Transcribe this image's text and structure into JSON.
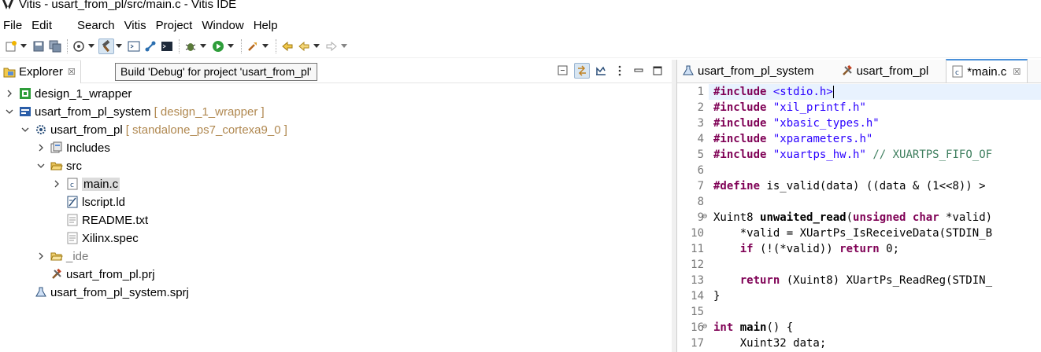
{
  "window": {
    "title": "Vitis - usart_from_pl/src/main.c - Vitis IDE"
  },
  "menu": [
    "File",
    "Edit",
    "Search",
    "Vitis",
    "Project",
    "Window",
    "Help"
  ],
  "toolbar": {
    "tooltip": "Build 'Debug' for project 'usart_from_pl'",
    "buttons": [
      "new-icon",
      "save-icon",
      "save-all-icon",
      "target-icon",
      "build-hammer-icon",
      "console-icon",
      "connect-icon",
      "terminal-icon",
      "debug-icon",
      "run-icon",
      "launch-icon",
      "prev-edit-icon",
      "back-icon",
      "forward-icon"
    ]
  },
  "explorer": {
    "tab_label": "Explorer",
    "close_glyph": "☒",
    "tree": [
      {
        "label": "design_1_wrapper",
        "deco": "",
        "icon": "platform-icon",
        "depth": 0,
        "expanded": false,
        "hasChildren": true
      },
      {
        "label": "usart_from_pl_system",
        "deco": "[ design_1_wrapper ]",
        "icon": "system-project-icon",
        "depth": 0,
        "expanded": true,
        "hasChildren": true
      },
      {
        "label": "usart_from_pl",
        "deco": "[ standalone_ps7_cortexa9_0 ]",
        "icon": "application-project-icon",
        "depth": 1,
        "expanded": true,
        "hasChildren": true
      },
      {
        "label": "Includes",
        "deco": "",
        "icon": "includes-icon",
        "depth": 2,
        "expanded": false,
        "hasChildren": true
      },
      {
        "label": "src",
        "deco": "",
        "icon": "folder-open-icon",
        "depth": 2,
        "expanded": true,
        "hasChildren": true
      },
      {
        "label": "main.c",
        "deco": "",
        "icon": "c-file-icon",
        "depth": 3,
        "expanded": false,
        "hasChildren": true,
        "selected": true
      },
      {
        "label": "lscript.ld",
        "deco": "",
        "icon": "linker-script-icon",
        "depth": 3,
        "expanded": false,
        "hasChildren": false
      },
      {
        "label": "README.txt",
        "deco": "",
        "icon": "text-file-icon",
        "depth": 3,
        "expanded": false,
        "hasChildren": false
      },
      {
        "label": "Xilinx.spec",
        "deco": "",
        "icon": "text-file-icon",
        "depth": 3,
        "expanded": false,
        "hasChildren": false
      },
      {
        "label": "_ide",
        "deco": "",
        "icon": "folder-icon",
        "depth": 2,
        "expanded": false,
        "hasChildren": true,
        "dim": true
      },
      {
        "label": "usart_from_pl.prj",
        "deco": "",
        "icon": "prj-file-icon",
        "depth": 2,
        "expanded": false,
        "hasChildren": false
      },
      {
        "label": "usart_from_pl_system.sprj",
        "deco": "",
        "icon": "sprj-file-icon",
        "depth": 1,
        "expanded": false,
        "hasChildren": false
      }
    ]
  },
  "editor": {
    "tabs": [
      {
        "label": "usart_from_pl_system",
        "icon": "flask-icon",
        "active": false
      },
      {
        "label": "usart_from_pl",
        "icon": "tools-icon",
        "active": false
      },
      {
        "label": "*main.c",
        "icon": "c-file-icon",
        "active": true
      }
    ],
    "lines": [
      {
        "n": "1",
        "fold": ""
      },
      {
        "n": "2",
        "fold": ""
      },
      {
        "n": "3",
        "fold": ""
      },
      {
        "n": "4",
        "fold": ""
      },
      {
        "n": "5",
        "fold": ""
      },
      {
        "n": "6",
        "fold": ""
      },
      {
        "n": "7",
        "fold": ""
      },
      {
        "n": "8",
        "fold": ""
      },
      {
        "n": "9",
        "fold": "⊖"
      },
      {
        "n": "10",
        "fold": ""
      },
      {
        "n": "11",
        "fold": ""
      },
      {
        "n": "12",
        "fold": ""
      },
      {
        "n": "13",
        "fold": ""
      },
      {
        "n": "14",
        "fold": ""
      },
      {
        "n": "15",
        "fold": ""
      },
      {
        "n": "16",
        "fold": "⊖"
      },
      {
        "n": "17",
        "fold": ""
      }
    ],
    "code": [
      [
        {
          "t": "#include",
          "c": "kw"
        },
        {
          "t": " ",
          "c": ""
        },
        {
          "t": "<stdio.h>",
          "c": "str"
        }
      ],
      [
        {
          "t": "#include",
          "c": "kw"
        },
        {
          "t": " ",
          "c": ""
        },
        {
          "t": "\"xil_printf.h\"",
          "c": "str"
        }
      ],
      [
        {
          "t": "#include",
          "c": "kw"
        },
        {
          "t": " ",
          "c": ""
        },
        {
          "t": "\"xbasic_types.h\"",
          "c": "str"
        }
      ],
      [
        {
          "t": "#include",
          "c": "kw"
        },
        {
          "t": " ",
          "c": ""
        },
        {
          "t": "\"xparameters.h\"",
          "c": "str"
        }
      ],
      [
        {
          "t": "#include",
          "c": "kw"
        },
        {
          "t": " ",
          "c": ""
        },
        {
          "t": "\"xuartps_hw.h\"",
          "c": "str"
        },
        {
          "t": " ",
          "c": ""
        },
        {
          "t": "// XUARTPS_FIFO_OF",
          "c": "cmt"
        }
      ],
      [],
      [
        {
          "t": "#define",
          "c": "kw"
        },
        {
          "t": " is_valid(data) ((data & (1<<8)) >",
          "c": ""
        }
      ],
      [],
      [
        {
          "t": "Xuint8 ",
          "c": ""
        },
        {
          "t": "unwaited_read",
          "c": "fn"
        },
        {
          "t": "(",
          "c": ""
        },
        {
          "t": "unsigned",
          "c": "kw"
        },
        {
          "t": " ",
          "c": ""
        },
        {
          "t": "char",
          "c": "kw"
        },
        {
          "t": " *valid)",
          "c": ""
        }
      ],
      [
        {
          "t": "    *valid = XUartPs_IsReceiveData(STDIN_B",
          "c": ""
        }
      ],
      [
        {
          "t": "    ",
          "c": ""
        },
        {
          "t": "if",
          "c": "kw"
        },
        {
          "t": " (!(*valid)) ",
          "c": ""
        },
        {
          "t": "return",
          "c": "kw"
        },
        {
          "t": " 0;",
          "c": ""
        }
      ],
      [],
      [
        {
          "t": "    ",
          "c": ""
        },
        {
          "t": "return",
          "c": "kw"
        },
        {
          "t": " (Xuint8) XUartPs_ReadReg(STDIN_",
          "c": ""
        }
      ],
      [
        {
          "t": "}",
          "c": ""
        }
      ],
      [],
      [
        {
          "t": "int",
          "c": "kw"
        },
        {
          "t": " ",
          "c": ""
        },
        {
          "t": "main",
          "c": "fn"
        },
        {
          "t": "() {",
          "c": ""
        }
      ],
      [
        {
          "t": "    Xuint32 data;",
          "c": ""
        }
      ]
    ]
  }
}
